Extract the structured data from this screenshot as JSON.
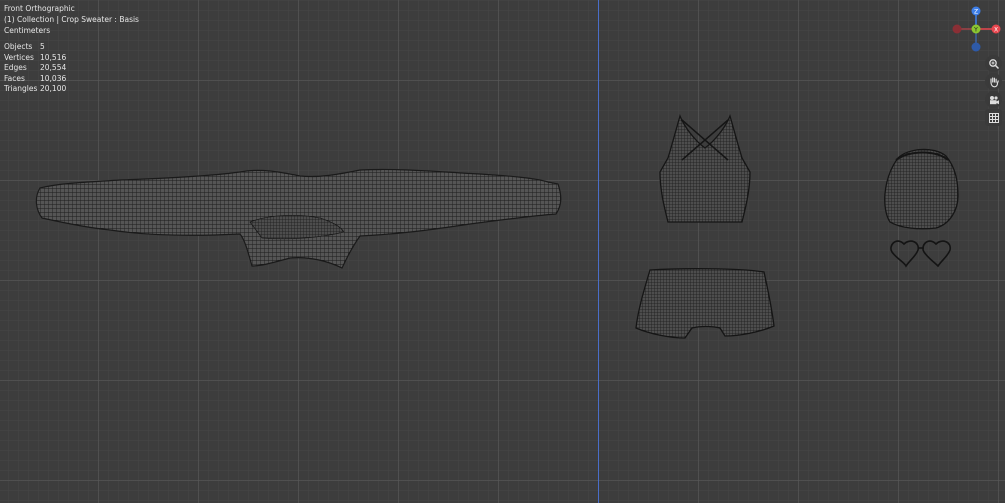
{
  "view": {
    "title": "Front Orthographic",
    "collection": "(1) Collection | Crop Sweater : Basis",
    "units": "Centimeters"
  },
  "stats": [
    {
      "label": "Objects",
      "value": "5"
    },
    {
      "label": "Vertices",
      "value": "10,516"
    },
    {
      "label": "Edges",
      "value": "20,554"
    },
    {
      "label": "Faces",
      "value": "10,036"
    },
    {
      "label": "Triangles",
      "value": "20,100"
    }
  ],
  "gizmo": {
    "z_label": "Z",
    "y_label": "Y",
    "x_label": "X",
    "z_color": "#3d7ee8",
    "y_color": "#8bc630",
    "x_color": "#e8464e"
  },
  "nav_icons": [
    "zoom-icon",
    "pan-hand-icon",
    "camera-icon",
    "grid-icon"
  ]
}
